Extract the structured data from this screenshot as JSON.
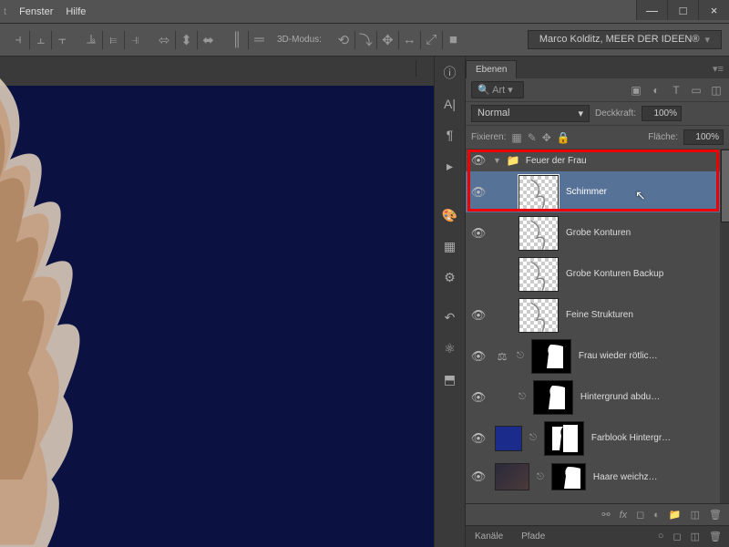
{
  "menu": {
    "fenster": "Fenster",
    "hilfe": "Hilfe"
  },
  "windowctrl": {
    "min": "—",
    "max": "□",
    "close": "×"
  },
  "options": {
    "mode3d": "3D-Modus:",
    "credit": "Marco Kolditz, MEER DER IDEEN®"
  },
  "panel": {
    "tab_ebenen": "Ebenen",
    "search_placeholder": "Art",
    "blend": "Normal",
    "deckkraft_label": "Deckkraft:",
    "deckkraft_value": "100%",
    "fixieren_label": "Fixieren:",
    "flaeche_label": "Fläche:",
    "flaeche_value": "100%"
  },
  "layers": {
    "group": "Feuer der Frau",
    "l1": "Schimmer",
    "l2": "Grobe Konturen",
    "l3": "Grobe Konturen Backup",
    "l4": "Feine Strukturen",
    "l5": "Frau wieder rötlic…",
    "l6": "Hintergrund abdu…",
    "l7": "Farblook Hintergr…",
    "l8": "Haare weichz…"
  },
  "bottom": {
    "kanaele": "Kanäle",
    "pfade": "Pfade"
  }
}
